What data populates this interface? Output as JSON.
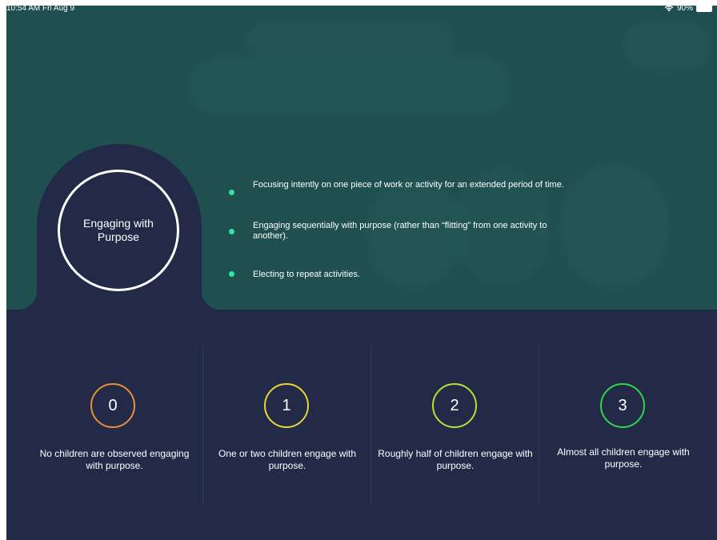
{
  "status_bar": {
    "time": "10:54 AM  Fri Aug 9",
    "wifi_icon": "wifi-icon",
    "battery": "90%"
  },
  "title": "Engaging with Purpose",
  "criteria": [
    "Focusing intently on one piece of work or activity for an extended period of time.",
    "Engaging sequentially with purpose (rather than “flitting” from one activity to another).",
    "Electing to repeat activities."
  ],
  "ratings": [
    {
      "score": "0",
      "description": "No children are observed engaging with purpose.",
      "color": "#e8903a"
    },
    {
      "score": "1",
      "description": "One or two children engage with purpose.",
      "color": "#e6d83a"
    },
    {
      "score": "2",
      "description": "Roughly half of children engage with purpose.",
      "color": "#b8e03a"
    },
    {
      "score": "3",
      "description": "Almost all children engage with purpose.",
      "color": "#2ed650"
    }
  ],
  "colors": {
    "top_panel": "#1f4f4f",
    "bottom_panel": "#222a47",
    "bullet": "#2ee6a0"
  }
}
